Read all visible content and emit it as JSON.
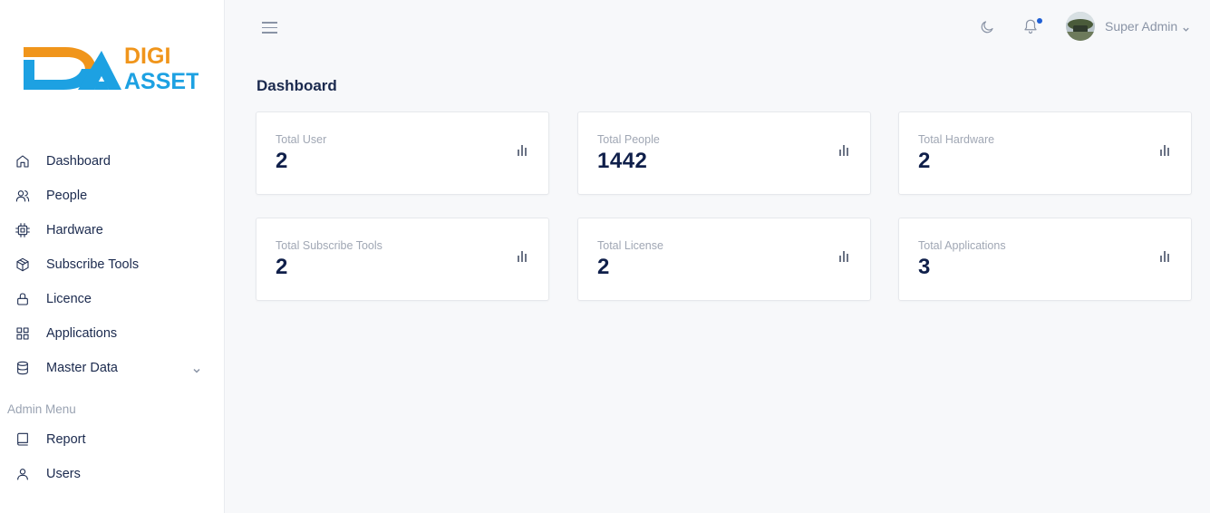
{
  "brand": {
    "logo_letters": "DA",
    "logo_word_top": "DIGI",
    "logo_word_bottom": "ASSET",
    "colors": {
      "orange": "#f0951b",
      "blue": "#1da1e2"
    }
  },
  "sidebar": {
    "items": [
      {
        "label": "Dashboard",
        "icon": "home-icon"
      },
      {
        "label": "People",
        "icon": "users-icon"
      },
      {
        "label": "Hardware",
        "icon": "cpu-icon"
      },
      {
        "label": "Subscribe Tools",
        "icon": "package-icon"
      },
      {
        "label": "Licence",
        "icon": "lock-icon"
      },
      {
        "label": "Applications",
        "icon": "grid-icon"
      },
      {
        "label": "Master Data",
        "icon": "database-icon",
        "has_submenu": true
      }
    ],
    "section_label": "Admin Menu",
    "admin_items": [
      {
        "label": "Report",
        "icon": "book-icon"
      },
      {
        "label": "Users",
        "icon": "user-icon"
      }
    ]
  },
  "header": {
    "user_name": "Super Admin",
    "notification_dot_color": "#1f5fd4"
  },
  "main": {
    "title": "Dashboard",
    "cards": [
      {
        "label": "Total User",
        "value": "2"
      },
      {
        "label": "Total People",
        "value": "1442"
      },
      {
        "label": "Total Hardware",
        "value": "2"
      },
      {
        "label": "Total Subscribe Tools",
        "value": "2"
      },
      {
        "label": "Total License",
        "value": "2"
      },
      {
        "label": "Total Applications",
        "value": "3"
      }
    ]
  }
}
